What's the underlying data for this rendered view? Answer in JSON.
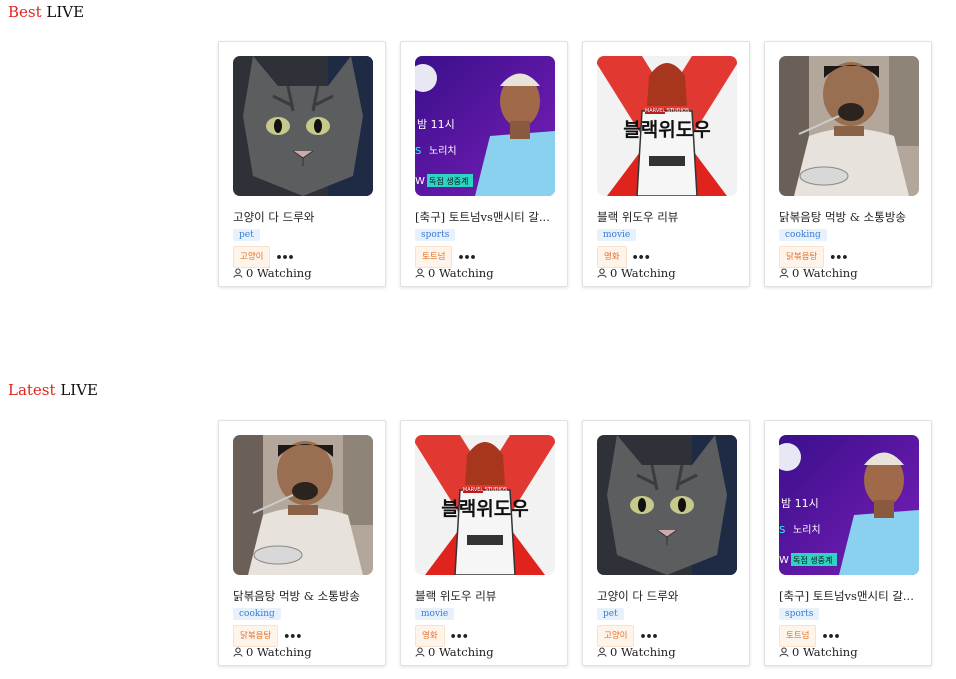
{
  "sections": {
    "best": {
      "accent": "Best",
      "rest": " LIVE"
    },
    "latest": {
      "accent": "Latest",
      "rest": " LIVE"
    }
  },
  "best_cards": [
    {
      "title": "고양이 다 드루와",
      "category": "pet",
      "tag": "고양이",
      "more": "•••",
      "watching": "0 Watching",
      "thumb": "cat"
    },
    {
      "title": "[축구] 토트넘vs맨시티 갈...",
      "category": "sports",
      "tag": "토트넘",
      "more": "•••",
      "watching": "0 Watching",
      "thumb": "soccer"
    },
    {
      "title": "블랙 위도우 리뷰",
      "category": "movie",
      "tag": "영화",
      "more": "•••",
      "watching": "0 Watching",
      "thumb": "movie"
    },
    {
      "title": "닭볶음탕 먹방 & 소통방송",
      "category": "cooking",
      "tag": "닭볶음탕",
      "more": "•••",
      "watching": "0 Watching",
      "thumb": "eating"
    }
  ],
  "latest_cards": [
    {
      "title": "닭볶음탕 먹방 & 소통방송",
      "category": "cooking",
      "tag": "닭볶음탕",
      "more": "•••",
      "watching": "0 Watching",
      "thumb": "eating"
    },
    {
      "title": "블랙 위도우 리뷰",
      "category": "movie",
      "tag": "영화",
      "more": "•••",
      "watching": "0 Watching",
      "thumb": "movie"
    },
    {
      "title": "고양이 다 드루와",
      "category": "pet",
      "tag": "고양이",
      "more": "•••",
      "watching": "0 Watching",
      "thumb": "cat"
    },
    {
      "title": "[축구] 토트넘vs맨시티 갈...",
      "category": "sports",
      "tag": "토트넘",
      "more": "•••",
      "watching": "0 Watching",
      "thumb": "soccer"
    }
  ],
  "thumb_text": {
    "soccer": {
      "time": "밤 11시",
      "team": "노리치",
      "badge": "독점 생중계"
    },
    "movie": {
      "brand": "MARVEL STUDIOS",
      "title": "블랙위도우"
    }
  },
  "colors": {
    "accent": "#e0231d",
    "category_bg": "#e7f1fc",
    "category_fg": "#3a7bd5",
    "tag_bg": "#fff4ea",
    "tag_fg": "#e3702a"
  }
}
